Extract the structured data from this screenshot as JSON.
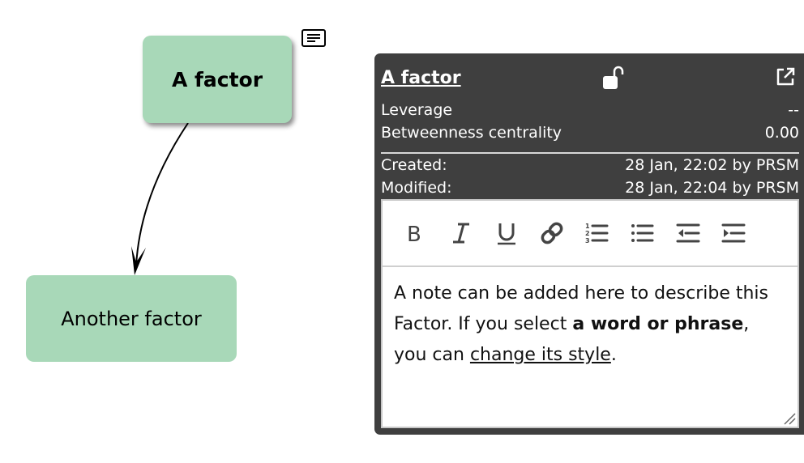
{
  "map": {
    "nodes": [
      {
        "id": "a",
        "label": "A factor",
        "color": "#a8d8b8",
        "selected": true
      },
      {
        "id": "b",
        "label": "Another factor",
        "color": "#a8d8b8"
      }
    ],
    "edges": [
      {
        "from": "a",
        "to": "b"
      }
    ],
    "note_icon": "note-icon"
  },
  "panel": {
    "title": "A factor",
    "lock_icon": "unlocked-padlock-icon",
    "open_icon": "external-link-icon",
    "stats": [
      {
        "label": "Leverage",
        "value": "--"
      },
      {
        "label": "Betweenness centrality",
        "value": "0.00"
      }
    ],
    "meta": [
      {
        "label": "Created:",
        "value": "28 Jan, 22:02 by PRSM"
      },
      {
        "label": "Modified:",
        "value": "28 Jan, 22:04 by PRSM"
      }
    ],
    "toolbar": [
      {
        "name": "bold",
        "icon": "bold-icon"
      },
      {
        "name": "italic",
        "icon": "italic-icon"
      },
      {
        "name": "underline",
        "icon": "underline-icon"
      },
      {
        "name": "link",
        "icon": "link-icon"
      },
      {
        "name": "ordered-list",
        "icon": "ordered-list-icon"
      },
      {
        "name": "bullet-list",
        "icon": "bullet-list-icon"
      },
      {
        "name": "outdent",
        "icon": "outdent-icon"
      },
      {
        "name": "indent",
        "icon": "indent-icon"
      }
    ],
    "note": {
      "part1": "A note can be added here to describe this Factor. If you select ",
      "bold": "a word or phrase",
      "part2": ", you can ",
      "underline": "change its style",
      "part3": "."
    }
  }
}
